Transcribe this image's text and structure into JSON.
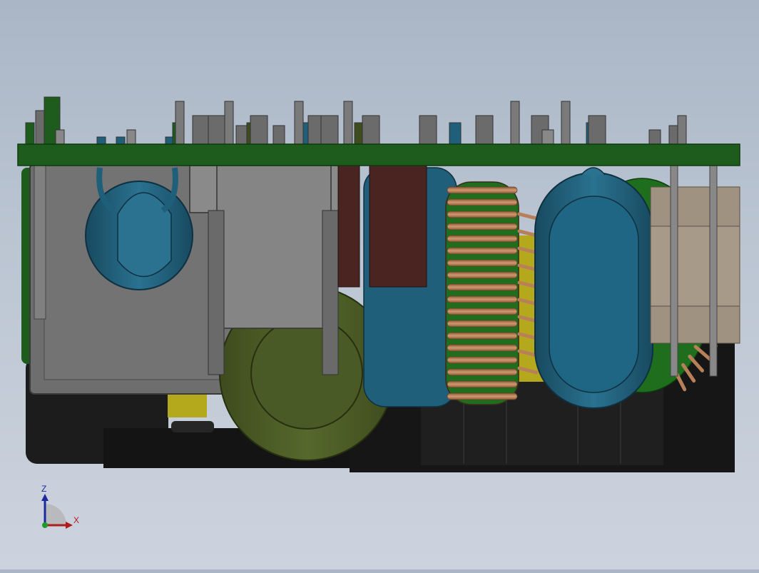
{
  "triad": {
    "z_label": "Z",
    "x_label": "X",
    "z_color": "#1c2a9c",
    "x_color": "#b01c1c",
    "y_color": "#1c9c2a"
  },
  "colors": {
    "background_top": "#aab6c6",
    "background_bottom": "#cdd3de",
    "pcb": "#1d5c1d",
    "housing_dark": "#1a1a1a",
    "steel_gray": "#6b6b6b",
    "capacitor_blue": "#1f5f7a",
    "toroid_olive": "#4a5a26",
    "copper": "#b88058",
    "winding_green": "#1e6e1e",
    "yellow_insulator": "#b4a81c",
    "maroon_block": "#4a2420",
    "tan_resistor": "#9f9280"
  }
}
